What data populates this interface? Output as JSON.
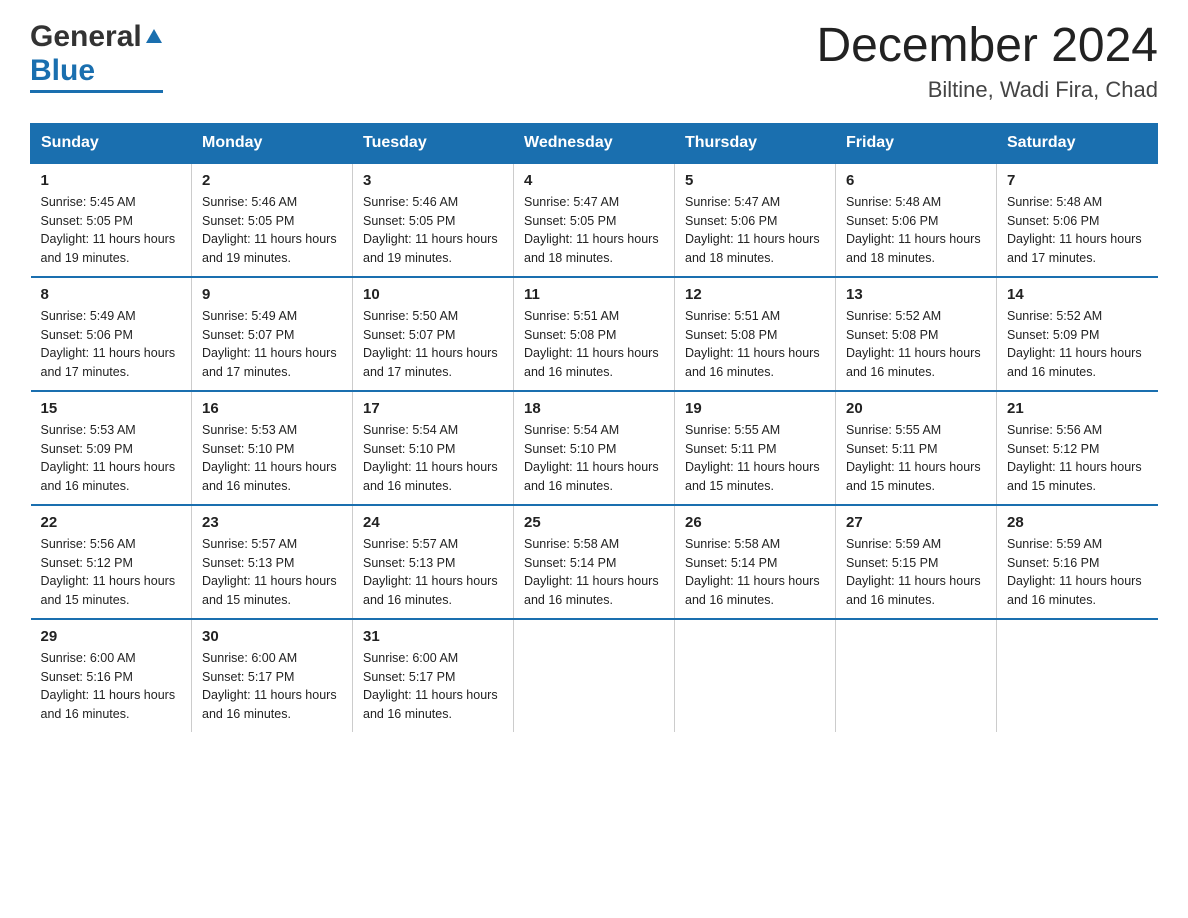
{
  "header": {
    "logo_general": "General",
    "logo_blue": "Blue",
    "title": "December 2024",
    "subtitle": "Biltine, Wadi Fira, Chad"
  },
  "days_of_week": [
    "Sunday",
    "Monday",
    "Tuesday",
    "Wednesday",
    "Thursday",
    "Friday",
    "Saturday"
  ],
  "weeks": [
    [
      {
        "day": "1",
        "sunrise": "5:45 AM",
        "sunset": "5:05 PM",
        "daylight": "11 hours and 19 minutes."
      },
      {
        "day": "2",
        "sunrise": "5:46 AM",
        "sunset": "5:05 PM",
        "daylight": "11 hours and 19 minutes."
      },
      {
        "day": "3",
        "sunrise": "5:46 AM",
        "sunset": "5:05 PM",
        "daylight": "11 hours and 19 minutes."
      },
      {
        "day": "4",
        "sunrise": "5:47 AM",
        "sunset": "5:05 PM",
        "daylight": "11 hours and 18 minutes."
      },
      {
        "day": "5",
        "sunrise": "5:47 AM",
        "sunset": "5:06 PM",
        "daylight": "11 hours and 18 minutes."
      },
      {
        "day": "6",
        "sunrise": "5:48 AM",
        "sunset": "5:06 PM",
        "daylight": "11 hours and 18 minutes."
      },
      {
        "day": "7",
        "sunrise": "5:48 AM",
        "sunset": "5:06 PM",
        "daylight": "11 hours and 17 minutes."
      }
    ],
    [
      {
        "day": "8",
        "sunrise": "5:49 AM",
        "sunset": "5:06 PM",
        "daylight": "11 hours and 17 minutes."
      },
      {
        "day": "9",
        "sunrise": "5:49 AM",
        "sunset": "5:07 PM",
        "daylight": "11 hours and 17 minutes."
      },
      {
        "day": "10",
        "sunrise": "5:50 AM",
        "sunset": "5:07 PM",
        "daylight": "11 hours and 17 minutes."
      },
      {
        "day": "11",
        "sunrise": "5:51 AM",
        "sunset": "5:08 PM",
        "daylight": "11 hours and 16 minutes."
      },
      {
        "day": "12",
        "sunrise": "5:51 AM",
        "sunset": "5:08 PM",
        "daylight": "11 hours and 16 minutes."
      },
      {
        "day": "13",
        "sunrise": "5:52 AM",
        "sunset": "5:08 PM",
        "daylight": "11 hours and 16 minutes."
      },
      {
        "day": "14",
        "sunrise": "5:52 AM",
        "sunset": "5:09 PM",
        "daylight": "11 hours and 16 minutes."
      }
    ],
    [
      {
        "day": "15",
        "sunrise": "5:53 AM",
        "sunset": "5:09 PM",
        "daylight": "11 hours and 16 minutes."
      },
      {
        "day": "16",
        "sunrise": "5:53 AM",
        "sunset": "5:10 PM",
        "daylight": "11 hours and 16 minutes."
      },
      {
        "day": "17",
        "sunrise": "5:54 AM",
        "sunset": "5:10 PM",
        "daylight": "11 hours and 16 minutes."
      },
      {
        "day": "18",
        "sunrise": "5:54 AM",
        "sunset": "5:10 PM",
        "daylight": "11 hours and 16 minutes."
      },
      {
        "day": "19",
        "sunrise": "5:55 AM",
        "sunset": "5:11 PM",
        "daylight": "11 hours and 15 minutes."
      },
      {
        "day": "20",
        "sunrise": "5:55 AM",
        "sunset": "5:11 PM",
        "daylight": "11 hours and 15 minutes."
      },
      {
        "day": "21",
        "sunrise": "5:56 AM",
        "sunset": "5:12 PM",
        "daylight": "11 hours and 15 minutes."
      }
    ],
    [
      {
        "day": "22",
        "sunrise": "5:56 AM",
        "sunset": "5:12 PM",
        "daylight": "11 hours and 15 minutes."
      },
      {
        "day": "23",
        "sunrise": "5:57 AM",
        "sunset": "5:13 PM",
        "daylight": "11 hours and 15 minutes."
      },
      {
        "day": "24",
        "sunrise": "5:57 AM",
        "sunset": "5:13 PM",
        "daylight": "11 hours and 16 minutes."
      },
      {
        "day": "25",
        "sunrise": "5:58 AM",
        "sunset": "5:14 PM",
        "daylight": "11 hours and 16 minutes."
      },
      {
        "day": "26",
        "sunrise": "5:58 AM",
        "sunset": "5:14 PM",
        "daylight": "11 hours and 16 minutes."
      },
      {
        "day": "27",
        "sunrise": "5:59 AM",
        "sunset": "5:15 PM",
        "daylight": "11 hours and 16 minutes."
      },
      {
        "day": "28",
        "sunrise": "5:59 AM",
        "sunset": "5:16 PM",
        "daylight": "11 hours and 16 minutes."
      }
    ],
    [
      {
        "day": "29",
        "sunrise": "6:00 AM",
        "sunset": "5:16 PM",
        "daylight": "11 hours and 16 minutes."
      },
      {
        "day": "30",
        "sunrise": "6:00 AM",
        "sunset": "5:17 PM",
        "daylight": "11 hours and 16 minutes."
      },
      {
        "day": "31",
        "sunrise": "6:00 AM",
        "sunset": "5:17 PM",
        "daylight": "11 hours and 16 minutes."
      },
      {
        "day": "",
        "sunrise": "",
        "sunset": "",
        "daylight": ""
      },
      {
        "day": "",
        "sunrise": "",
        "sunset": "",
        "daylight": ""
      },
      {
        "day": "",
        "sunrise": "",
        "sunset": "",
        "daylight": ""
      },
      {
        "day": "",
        "sunrise": "",
        "sunset": "",
        "daylight": ""
      }
    ]
  ],
  "labels": {
    "sunrise": "Sunrise:",
    "sunset": "Sunset:",
    "daylight": "Daylight:"
  }
}
